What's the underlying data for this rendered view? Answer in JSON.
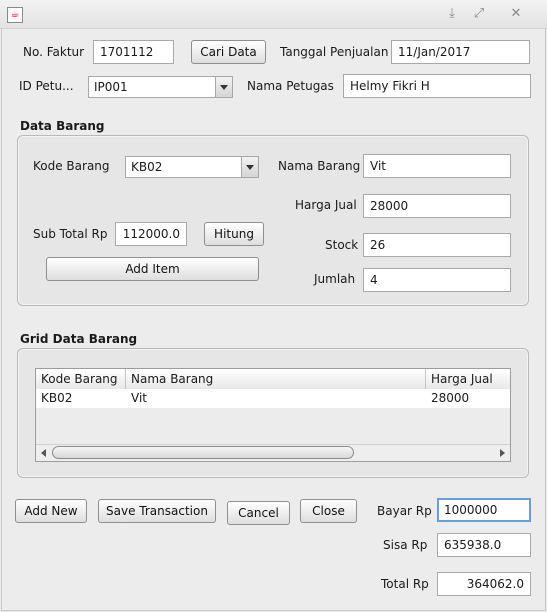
{
  "window": {
    "title_icon": "java-app-icon",
    "controls": [
      "minimize-icon",
      "maximize-icon",
      "close-icon"
    ]
  },
  "header": {
    "no_faktur_label": "No. Faktur",
    "no_faktur_value": "1701112",
    "cari_data_label": "Cari Data",
    "tanggal_label": "Tanggal Penjualan",
    "tanggal_value": "11/Jan/2017",
    "id_petugas_label": "ID Petu...",
    "id_petugas_value": "IP001",
    "nama_petugas_label": "Nama Petugas",
    "nama_petugas_value": "Helmy Fikri H"
  },
  "data_barang": {
    "title": "Data Barang",
    "kode_label": "Kode Barang",
    "kode_value": "KB02",
    "nama_label": "Nama Barang",
    "nama_value": "Vit",
    "harga_label": "Harga Jual",
    "harga_value": "28000",
    "subtotal_label": "Sub Total  Rp",
    "subtotal_value": "112000.0",
    "hitung_label": "Hitung",
    "stock_label": "Stock",
    "stock_value": "26",
    "add_item_label": "Add Item",
    "jumlah_label": "Jumlah",
    "jumlah_value": "4"
  },
  "grid": {
    "title": "Grid Data Barang",
    "columns": [
      "Kode Barang",
      "Nama Barang",
      "Harga Jual"
    ],
    "rows": [
      [
        "KB02",
        "Vit",
        "28000"
      ]
    ]
  },
  "footer": {
    "add_new_label": "Add New",
    "save_label": "Save Transaction",
    "cancel_label": "Cancel",
    "close_label": "Close",
    "bayar_label": "Bayar  Rp",
    "bayar_value": "1000000",
    "sisa_label": "Sisa  Rp",
    "sisa_value": "635938.0",
    "total_label": "Total  Rp",
    "total_value": "364062.0"
  },
  "colors": {
    "focus_border": "#6a9fd3",
    "panel_bg": "#ececec"
  }
}
